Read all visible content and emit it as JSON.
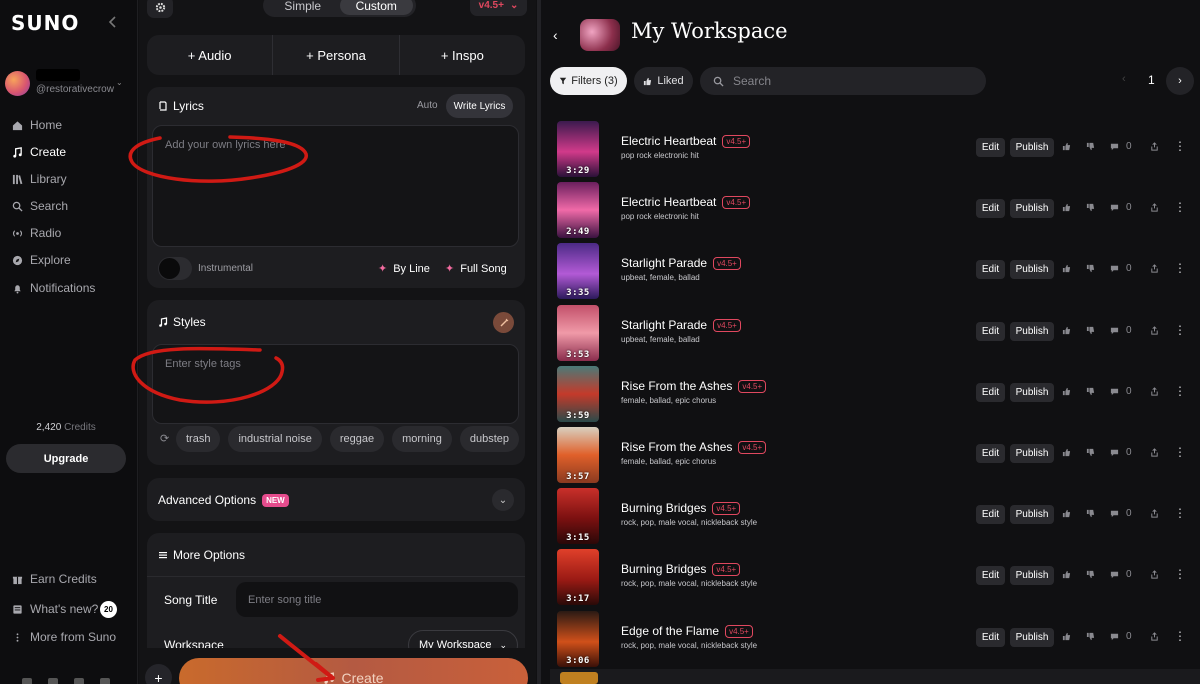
{
  "brand": {
    "logo": "SUNO"
  },
  "user": {
    "handle": "@restorativecrowc"
  },
  "nav": [
    {
      "label": "Home",
      "icon": "home-icon"
    },
    {
      "label": "Create",
      "icon": "create-icon"
    },
    {
      "label": "Library",
      "icon": "library-icon"
    },
    {
      "label": "Search",
      "icon": "search-icon"
    },
    {
      "label": "Radio",
      "icon": "radio-icon"
    },
    {
      "label": "Explore",
      "icon": "explore-icon"
    },
    {
      "label": "Notifications",
      "icon": "bell-icon"
    }
  ],
  "credits": {
    "value": "2,420",
    "label": "Credits"
  },
  "upgrade_label": "Upgrade",
  "footer_nav": [
    {
      "label": "Earn Credits",
      "icon": "gift-icon"
    },
    {
      "label": "What's new?",
      "icon": "news-icon",
      "badge": "20"
    },
    {
      "label": "More from Suno",
      "icon": "more-icon"
    }
  ],
  "mode": {
    "simple": "Simple",
    "custom": "Custom",
    "active": "Custom"
  },
  "version": "v4.5+",
  "add_buttons": {
    "audio": "+ Audio",
    "persona": "+ Persona",
    "inspo": "+ Inspo"
  },
  "lyrics": {
    "title": "Lyrics",
    "auto": "Auto",
    "write": "Write Lyrics",
    "placeholder": "Add your own lyrics here",
    "instrumental": "Instrumental",
    "by_line": "By Line",
    "full_song": "Full Song"
  },
  "styles": {
    "title": "Styles",
    "placeholder": "Enter style tags",
    "tags": [
      "trash",
      "industrial noise",
      "reggae",
      "morning",
      "dubstep"
    ]
  },
  "advanced": {
    "label": "Advanced Options",
    "badge": "NEW"
  },
  "more_options": {
    "label": "More Options",
    "song_title_label": "Song Title",
    "song_title_placeholder": "Enter song title",
    "workspace_label": "Workspace",
    "workspace_value": "My Workspace"
  },
  "create_label": "Create",
  "workspace": {
    "title": "My Workspace"
  },
  "toolbar": {
    "filters": "Filters (3)",
    "liked": "Liked",
    "search_placeholder": "Search",
    "page": "1"
  },
  "row_actions": {
    "edit": "Edit",
    "publish": "Publish"
  },
  "songs": [
    {
      "title": "Electric Heartbeat",
      "version": "v4.5+",
      "tags": "pop rock electronic hit",
      "duration": "3:29",
      "comments": "0",
      "thumb": "linear-gradient(180deg,#3b1a4e,#d13a8a 55%,#2a1138)"
    },
    {
      "title": "Electric Heartbeat",
      "version": "v4.5+",
      "tags": "pop rock electronic hit",
      "duration": "2:49",
      "comments": "0",
      "thumb": "linear-gradient(180deg,#6a1f5e,#f06aa8 50%,#3a1240)"
    },
    {
      "title": "Starlight Parade",
      "version": "v4.5+",
      "tags": "upbeat, female, ballad",
      "duration": "3:35",
      "comments": "0",
      "thumb": "linear-gradient(180deg,#4b2a86,#b35ad6 55%,#2c1a5c)"
    },
    {
      "title": "Starlight Parade",
      "version": "v4.5+",
      "tags": "upbeat, female, ballad",
      "duration": "3:53",
      "comments": "0",
      "thumb": "linear-gradient(180deg,#c2506a,#f09aa8 50%,#8a2c4c)"
    },
    {
      "title": "Rise From the Ashes",
      "version": "v4.5+",
      "tags": "female, ballad, epic chorus",
      "duration": "3:59",
      "comments": "0",
      "thumb": "linear-gradient(180deg,#4a7a78,#c43a2a 50%,#2a4a4a)"
    },
    {
      "title": "Rise From the Ashes",
      "version": "v4.5+",
      "tags": "female, ballad, epic chorus",
      "duration": "3:57",
      "comments": "0",
      "thumb": "linear-gradient(180deg,#d8d0c0,#e0602a 50%,#8a3a20)"
    },
    {
      "title": "Burning Bridges",
      "version": "v4.5+",
      "tags": "rock, pop, male vocal, nickleback style",
      "duration": "3:15",
      "comments": "0",
      "thumb": "linear-gradient(180deg,#c9302a,#7a1010 55%,#2a0808)"
    },
    {
      "title": "Burning Bridges",
      "version": "v4.5+",
      "tags": "rock, pop, male vocal, nickleback style",
      "duration": "3:17",
      "comments": "0",
      "thumb": "linear-gradient(180deg,#e0402a,#9a1a14 55%,#2a0a08)"
    },
    {
      "title": "Edge of the Flame",
      "version": "v4.5+",
      "tags": "rock, pop, male vocal, nickleback style",
      "duration": "3:06",
      "comments": "0",
      "thumb": "linear-gradient(180deg,#2a1a14,#d0501a 55%,#3a1008)"
    }
  ]
}
